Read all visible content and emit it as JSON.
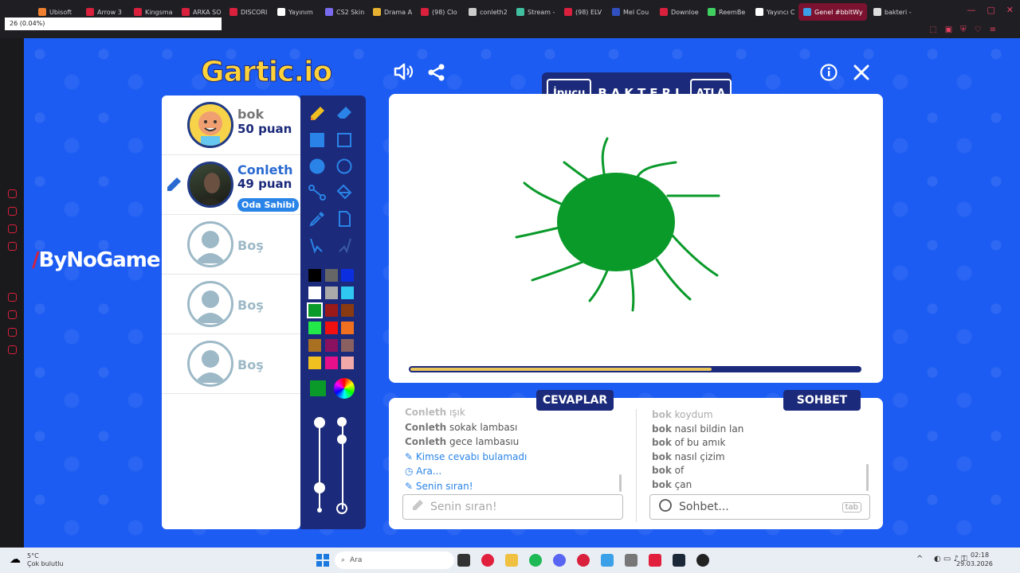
{
  "browser": {
    "tabs": [
      {
        "label": "Ubisoft",
        "color": "#f08030"
      },
      {
        "label": "Arrow 3",
        "color": "#d9203c"
      },
      {
        "label": "Kingsma",
        "color": "#d9203c"
      },
      {
        "label": "ARKA SO",
        "color": "#d9203c"
      },
      {
        "label": "DISCORI",
        "color": "#d9203c"
      },
      {
        "label": "Yayınım",
        "color": "#ffffff"
      },
      {
        "label": "CS2 Skin",
        "color": "#7a6af0"
      },
      {
        "label": "Drama A",
        "color": "#e8b030"
      },
      {
        "label": "(98) Clo",
        "color": "#d9203c"
      },
      {
        "label": "conleth2",
        "color": "#cccccc"
      },
      {
        "label": "Stream -",
        "color": "#40c0a0"
      },
      {
        "label": "(98) ELV",
        "color": "#d9203c"
      },
      {
        "label": "Mel Cou",
        "color": "#3050c0"
      },
      {
        "label": "Downloe",
        "color": "#d9203c"
      },
      {
        "label": "ReemBe",
        "color": "#40d060"
      },
      {
        "label": "Yayıncı C",
        "color": "#ffffff"
      },
      {
        "label": "Genel #bbltWy",
        "color": "#3aa0e8"
      },
      {
        "label": "bakteri -",
        "color": "#dddddd"
      }
    ],
    "overlay_text": "26 (0.04%)"
  },
  "sidebar_brand": "ByNoGame",
  "game": {
    "logo": "Gartic.io",
    "hint_label": "İpucu",
    "word": "BAKTERI",
    "skip_label": "ATLA",
    "timer_progress": 0.67
  },
  "players": [
    {
      "name": "bok",
      "score": "50 puan",
      "type": "cartoon"
    },
    {
      "name": "Conleth",
      "score": "49 puan",
      "type": "photo",
      "badge": "Oda Sahibi",
      "drawing": true
    },
    {
      "name": "Boş",
      "type": "empty"
    },
    {
      "name": "Boş",
      "type": "empty"
    },
    {
      "name": "Boş",
      "type": "empty"
    }
  ],
  "palette": [
    "#000000",
    "#666666",
    "#0b2fe0",
    "#ffffff",
    "#aaaaaa",
    "#2ec8f0",
    "#0a9a2a",
    "#9a1a1a",
    "#8a3a10",
    "#22e84a",
    "#f01010",
    "#f07020",
    "#a87020",
    "#8a1060",
    "#8a6060",
    "#f0c020",
    "#e8108a",
    "#f0a8a8"
  ],
  "selected_color": "#0a9a2a",
  "answers": {
    "tab_label": "CEVAPLAR",
    "messages": [
      {
        "user": "Conleth",
        "text": "ışık"
      },
      {
        "user": "Conleth",
        "text": "sokak lambası"
      },
      {
        "user": "Conleth",
        "text": "gece lambasıu"
      },
      {
        "system": "Kimse cevabı bulamadı"
      },
      {
        "system": "Ara..."
      },
      {
        "system": "Senin sıran!"
      }
    ],
    "input_placeholder": "Senin sıran!"
  },
  "chat": {
    "tab_label": "SOHBET",
    "messages": [
      {
        "user": "bok",
        "text": "koydum"
      },
      {
        "user": "bok",
        "text": "nasıl bildin lan"
      },
      {
        "user": "bok",
        "text": "of bu amık"
      },
      {
        "user": "bok",
        "text": "nasıl çizim"
      },
      {
        "user": "bok",
        "text": "of"
      },
      {
        "user": "bok",
        "text": "çan"
      }
    ],
    "input_placeholder": "Sohbet...",
    "tab_key_hint": "tab"
  },
  "taskbar": {
    "weather_temp": "5°C",
    "weather_text": "Çok bulutlu",
    "search_label": "Ara",
    "time": "02:18",
    "date": "29.03.2026"
  }
}
